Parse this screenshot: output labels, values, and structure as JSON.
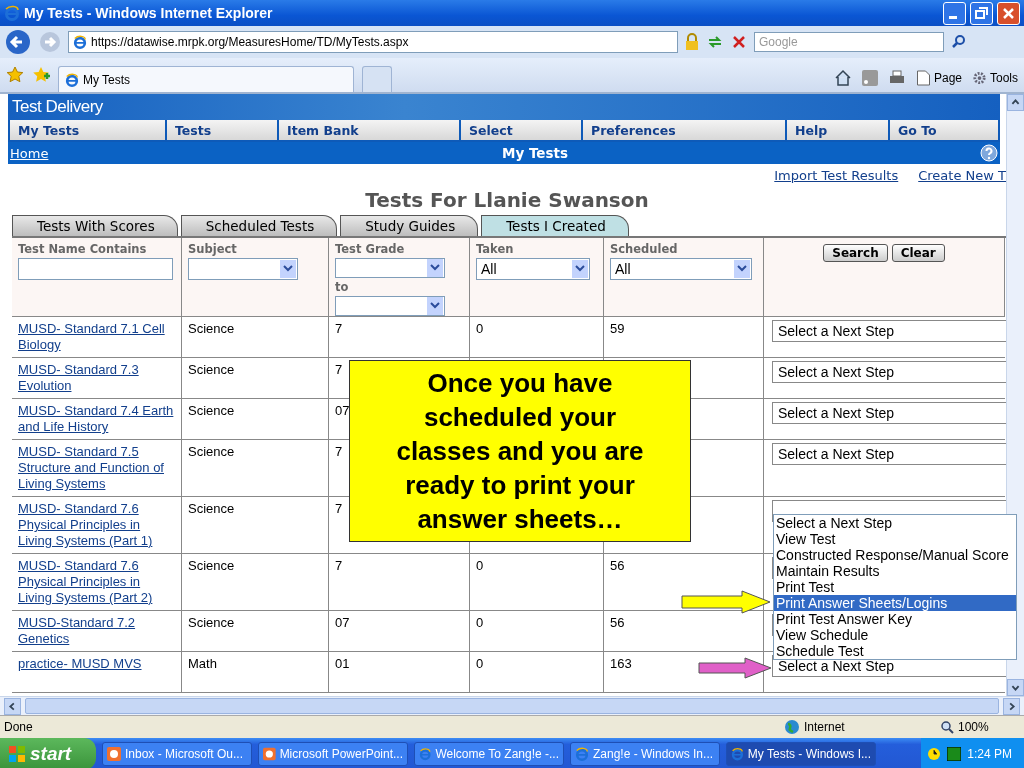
{
  "window": {
    "title": "My Tests - Windows Internet Explorer"
  },
  "address_bar": {
    "url": "https://datawise.mrpk.org/MeasuresHome/TD/MyTests.aspx"
  },
  "search": {
    "placeholder": "Google"
  },
  "browser_tabs": [
    {
      "label": "My Tests",
      "selected": true
    }
  ],
  "command_bar": [
    "Page",
    "Tools"
  ],
  "site": {
    "title": "Test Delivery",
    "menu": [
      "My Tests",
      "Tests",
      "Item Bank",
      "Select",
      "Preferences",
      "Help",
      "Go To"
    ],
    "breadcrumb": "Home",
    "page_title": "My Tests",
    "links": [
      "Import Test Results",
      "Create New T"
    ],
    "heading": "Tests For Llanie Swanson"
  },
  "tabs": [
    {
      "label": "Tests With Scores",
      "selected": false
    },
    {
      "label": "Scheduled Tests",
      "selected": false
    },
    {
      "label": "Study Guides",
      "selected": false
    },
    {
      "label": "Tests I Created",
      "selected": true
    }
  ],
  "filters": [
    {
      "label": "Test Name Contains",
      "kind": "text"
    },
    {
      "label": "Subject",
      "kind": "select"
    },
    {
      "label": "Test Grade",
      "kind": "range",
      "to_label": "to"
    },
    {
      "label": "Taken",
      "kind": "select",
      "value": "All"
    },
    {
      "label": "Scheduled",
      "kind": "select",
      "value": "All"
    }
  ],
  "filter_buttons": [
    "Search",
    "Clear"
  ],
  "rows": [
    {
      "name": "MUSD- Standard 7.1 Cell Biology",
      "subject": "Science",
      "grade": "7",
      "taken": "0",
      "scheduled": "59",
      "next_step": "Select a Next Step"
    },
    {
      "name": "MUSD- Standard 7.3 Evolution",
      "subject": "Science",
      "grade": "7",
      "next_step": "Select a Next Step"
    },
    {
      "name": "MUSD- Standard 7.4 Earth and Life History",
      "subject": "Science",
      "grade": "07",
      "next_step": "Select a Next Step"
    },
    {
      "name": "MUSD- Standard 7.5 Structure and Function of Living Systems",
      "subject": "Science",
      "grade": "7",
      "next_step": "Select a Next Step"
    },
    {
      "name": "MUSD- Standard 7.6 Physical Principles in Living Systems (Part 1)",
      "subject": "Science",
      "grade": "7"
    },
    {
      "name": "MUSD- Standard 7.6 Physical Principles in Living Systems (Part 2)",
      "subject": "Science",
      "grade": "7",
      "taken": "0",
      "scheduled": "56"
    },
    {
      "name": "MUSD-Standard 7.2 Genetics",
      "subject": "Science",
      "grade": "07",
      "taken": "0",
      "scheduled": "56"
    },
    {
      "name": "practice- MUSD MVS",
      "subject": "Math",
      "grade": "01",
      "taken": "0",
      "scheduled": "163",
      "next_step": "Select a Next Step"
    }
  ],
  "dropdown": {
    "options": [
      {
        "label": "Select a Next Step",
        "selected": false
      },
      {
        "label": "View Test",
        "selected": false
      },
      {
        "label": "Constructed Response/Manual Score",
        "selected": false
      },
      {
        "label": "Maintain Results",
        "selected": false
      },
      {
        "label": "Print Test",
        "selected": false
      },
      {
        "label": "Print Answer Sheets/Logins",
        "selected": true
      },
      {
        "label": "Print Test Answer Key",
        "selected": false
      },
      {
        "label": "View Schedule",
        "selected": false
      },
      {
        "label": "Schedule Test",
        "selected": false
      }
    ]
  },
  "callout": {
    "text": "Once you have scheduled your classes and you are ready to print your answer sheets…"
  },
  "status_bar": {
    "text": "Done",
    "zone": "Internet",
    "zoom": "100%"
  },
  "taskbar": {
    "start": "start",
    "items": [
      {
        "label": "Inbox - Microsoft Ou...",
        "selected": false
      },
      {
        "label": "Microsoft PowerPoint...",
        "selected": false
      },
      {
        "label": "Welcome To Zang!e -...",
        "selected": false
      },
      {
        "label": "Zang!e - Windows In...",
        "selected": false
      },
      {
        "label": "My Tests - Windows I...",
        "selected": true
      }
    ],
    "clock": "1:24 PM"
  }
}
